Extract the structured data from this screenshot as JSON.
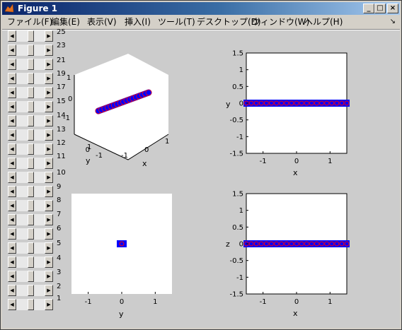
{
  "window": {
    "title": "Figure 1",
    "controls": {
      "minimize": "_",
      "maximize": "□",
      "close": "×"
    },
    "dock_glyph": "↘"
  },
  "menu": [
    {
      "label": "ファイル(F)"
    },
    {
      "label": "編集(E)"
    },
    {
      "label": "表示(V)"
    },
    {
      "label": "挿入(I)"
    },
    {
      "label": "ツール(T)"
    },
    {
      "label": "デスクトップ(D)"
    },
    {
      "label": "ウィンドウ(W)"
    },
    {
      "label": "ヘルプ(H)"
    }
  ],
  "slider_labels": [
    "25",
    "23",
    "21",
    "19",
    "17",
    "15",
    "14",
    "13",
    "12",
    "11",
    "10",
    "9",
    "8",
    "7",
    "6",
    "5",
    "4",
    "3",
    "2",
    "1"
  ],
  "colors": {
    "title_start": "#0a246a",
    "title_end": "#a6caf0",
    "marker_fill": "#0000ff",
    "marker_edge": "#ff0000",
    "figure_bg": "#cccccc",
    "axes_bg": "#ffffff"
  },
  "chart_data": [
    {
      "type": "scatter",
      "view": "3d",
      "xlabel": "x",
      "ylabel": "y",
      "zlabel": "",
      "xticks": [
        "-1",
        "0",
        "1"
      ],
      "yticks": [
        "-1",
        "0",
        "1"
      ],
      "zticks": [
        "-1",
        "0",
        "1"
      ],
      "points": "diagonal chain of blue markers with red edges"
    },
    {
      "type": "scatter",
      "xlabel": "x",
      "ylabel": "y",
      "xlim": [
        -1.5,
        1.5
      ],
      "ylim": [
        -1.5,
        1.5
      ],
      "xticks": [
        "-1",
        "0",
        "1"
      ],
      "yticks": [
        "1.5",
        "1",
        "0.5",
        "0",
        "-0.5",
        "-1",
        "-1.5"
      ],
      "series": [
        {
          "x": [
            -1.5,
            -1.35,
            -1.2,
            -1.05,
            -0.9,
            -0.75,
            -0.6,
            -0.45,
            -0.3,
            -0.15,
            0,
            0.15,
            0.3,
            0.45,
            0.6,
            0.75,
            0.9,
            1.05,
            1.2,
            1.35,
            1.5
          ],
          "y": [
            0,
            0,
            0,
            0,
            0,
            0,
            0,
            0,
            0,
            0,
            0,
            0,
            0,
            0,
            0,
            0,
            0,
            0,
            0,
            0,
            0
          ]
        }
      ]
    },
    {
      "type": "scatter",
      "xlabel": "y",
      "ylabel": "",
      "xlim": [
        -1.5,
        1.5
      ],
      "xticks": [
        "-1",
        "0",
        "1"
      ],
      "series": [
        {
          "x": [
            0
          ],
          "y": [
            0
          ]
        }
      ]
    },
    {
      "type": "scatter",
      "xlabel": "x",
      "ylabel": "z",
      "xlim": [
        -1.5,
        1.5
      ],
      "ylim": [
        -1.5,
        1.5
      ],
      "xticks": [
        "-1",
        "0",
        "1"
      ],
      "yticks": [
        "1.5",
        "1",
        "0.5",
        "0",
        "-0.5",
        "-1",
        "-1.5"
      ],
      "series": [
        {
          "x": [
            -1.5,
            -1.35,
            -1.2,
            -1.05,
            -0.9,
            -0.75,
            -0.6,
            -0.45,
            -0.3,
            -0.15,
            0,
            0.15,
            0.3,
            0.45,
            0.6,
            0.75,
            0.9,
            1.05,
            1.2,
            1.35,
            1.5
          ],
          "y": [
            0,
            0,
            0,
            0,
            0,
            0,
            0,
            0,
            0,
            0,
            0,
            0,
            0,
            0,
            0,
            0,
            0,
            0,
            0,
            0,
            0
          ]
        }
      ]
    }
  ]
}
